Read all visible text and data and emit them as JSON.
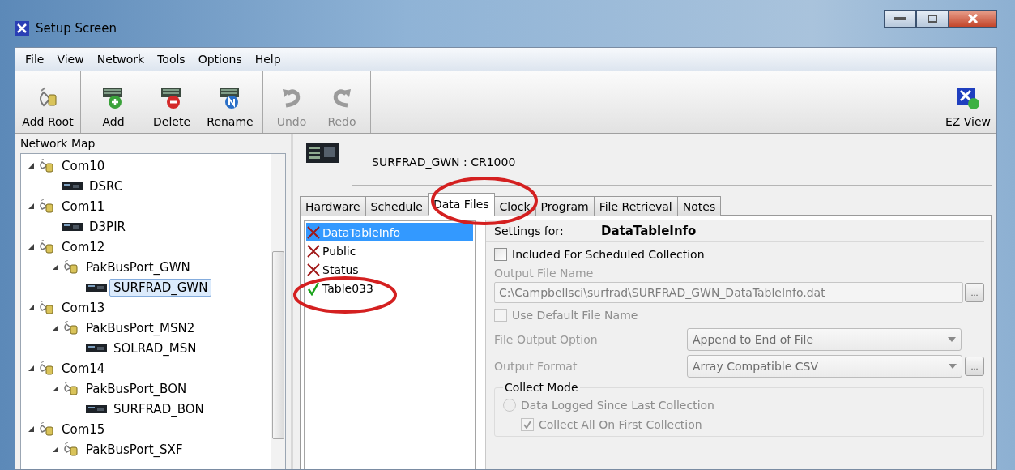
{
  "window": {
    "title": "Setup Screen"
  },
  "menu": [
    "File",
    "View",
    "Network",
    "Tools",
    "Options",
    "Help"
  ],
  "toolbar": [
    {
      "label": "Add Root",
      "kind": "root",
      "disabled": false
    },
    {
      "label": "Add",
      "kind": "add",
      "disabled": false
    },
    {
      "label": "Delete",
      "kind": "delete",
      "disabled": false
    },
    {
      "label": "Rename",
      "kind": "rename",
      "disabled": false
    },
    {
      "label": "Undo",
      "kind": "undo",
      "disabled": true
    },
    {
      "label": "Redo",
      "kind": "redo",
      "disabled": true
    }
  ],
  "ez_view": {
    "label": "EZ View"
  },
  "network_map": {
    "title": "Network Map",
    "items": [
      {
        "label": "Com10",
        "kind": "port",
        "expanded": true,
        "selected": false,
        "children": [
          {
            "label": "DSRC",
            "kind": "logger",
            "selected": false
          }
        ]
      },
      {
        "label": "Com11",
        "kind": "port",
        "expanded": true,
        "selected": false,
        "children": [
          {
            "label": "D3PIR",
            "kind": "logger",
            "selected": false
          }
        ]
      },
      {
        "label": "Com12",
        "kind": "port",
        "expanded": true,
        "selected": false,
        "children": [
          {
            "label": "PakBusPort_GWN",
            "kind": "port",
            "expanded": true,
            "selected": false,
            "children": [
              {
                "label": "SURFRAD_GWN",
                "kind": "logger",
                "selected": true
              }
            ]
          }
        ]
      },
      {
        "label": "Com13",
        "kind": "port",
        "expanded": true,
        "selected": false,
        "children": [
          {
            "label": "PakBusPort_MSN2",
            "kind": "port",
            "expanded": true,
            "selected": false,
            "children": [
              {
                "label": "SOLRAD_MSN",
                "kind": "logger",
                "selected": false
              }
            ]
          }
        ]
      },
      {
        "label": "Com14",
        "kind": "port",
        "expanded": true,
        "selected": false,
        "children": [
          {
            "label": "PakBusPort_BON",
            "kind": "port",
            "expanded": true,
            "selected": false,
            "children": [
              {
                "label": "SURFRAD_BON",
                "kind": "logger",
                "selected": false
              }
            ]
          }
        ]
      },
      {
        "label": "Com15",
        "kind": "port",
        "expanded": true,
        "selected": false,
        "children": [
          {
            "label": "PakBusPort_SXF",
            "kind": "port",
            "expanded": true,
            "selected": false
          }
        ]
      }
    ]
  },
  "device": {
    "label": "SURFRAD_GWN : CR1000"
  },
  "tabs": [
    {
      "label": "Hardware",
      "selected": false
    },
    {
      "label": "Schedule",
      "selected": false
    },
    {
      "label": "Data Files",
      "selected": true
    },
    {
      "label": "Clock",
      "selected": false
    },
    {
      "label": "Program",
      "selected": false
    },
    {
      "label": "File Retrieval",
      "selected": false
    },
    {
      "label": "Notes",
      "selected": false
    }
  ],
  "tables": [
    {
      "label": "DataTableInfo",
      "kind": "cross",
      "selected": true
    },
    {
      "label": "Public",
      "kind": "cross",
      "selected": false
    },
    {
      "label": "Status",
      "kind": "cross",
      "selected": false
    },
    {
      "label": "Table033",
      "kind": "check",
      "selected": false
    }
  ],
  "settings": {
    "heading_label": "Settings for:",
    "heading_value": "DataTableInfo",
    "scheduled": {
      "label": "Included For Scheduled Collection",
      "checked": false,
      "disabled": false
    },
    "output_file_name": {
      "label": "Output File Name",
      "value": "C:\\Campbellsci\\surfrad\\SURFRAD_GWN_DataTableInfo.dat",
      "browse": "...",
      "disabled": true
    },
    "use_default": {
      "label": "Use Default File Name",
      "checked": false,
      "disabled": true
    },
    "file_output_option": {
      "label": "File Output Option",
      "value": "Append to End of File"
    },
    "output_format": {
      "label": "Output Format",
      "value": "Array Compatible CSV",
      "browse": "..."
    },
    "collect_mode": {
      "title": "Collect Mode",
      "options": [
        {
          "label": "Data Logged Since Last Collection",
          "kind": "radio",
          "selected": false,
          "disabled": true
        },
        {
          "label": "Collect All On First Collection",
          "kind": "checkbox",
          "checked": true,
          "disabled": true
        }
      ]
    }
  }
}
